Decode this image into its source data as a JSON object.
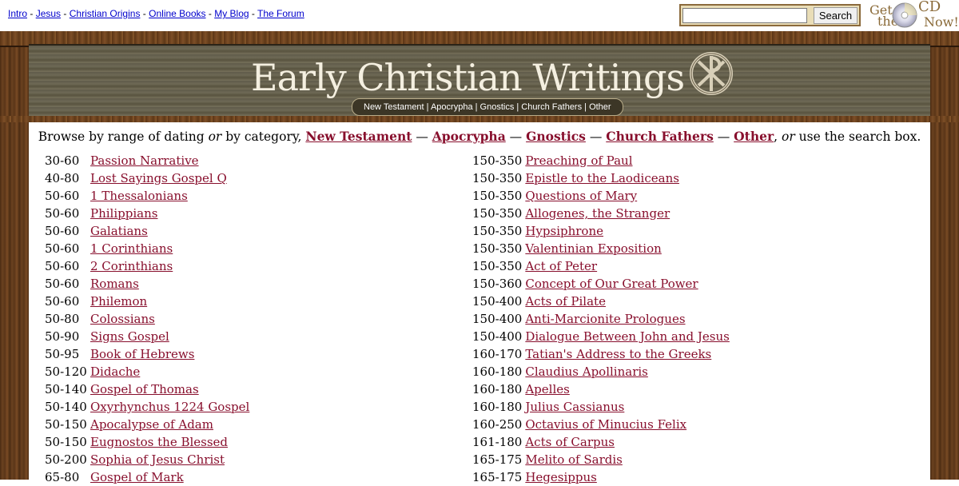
{
  "topnav": {
    "links": [
      "Intro",
      "Jesus",
      "Christian Origins",
      "Online Books",
      "My Blog",
      "The Forum"
    ],
    "separator": "-"
  },
  "search": {
    "value": "",
    "button_label": "Search"
  },
  "cd_promo": {
    "line1": "Get",
    "line2": "the",
    "line3": "CD",
    "line4": "Now!"
  },
  "header": {
    "title": "Early Christian Writings",
    "categories_bar": "New Testament | Apocrypha | Gnostics | Church Fathers | Other"
  },
  "intro": {
    "text1": "Browse by range of dating ",
    "or1": "or",
    "text2": " by category, ",
    "cat1": "New Testament",
    "dash1": " — ",
    "cat2": "Apocrypha",
    "dash2": " — ",
    "cat3": "Gnostics",
    "dash3": " — ",
    "cat4": "Church Fathers",
    "dash4": " — ",
    "cat5": "Other",
    "comma": ", ",
    "or2": "or",
    "text3": " use the search box."
  },
  "left_list": [
    {
      "date": "30-60",
      "title": "Passion Narrative"
    },
    {
      "date": "40-80",
      "title": "Lost Sayings Gospel Q"
    },
    {
      "date": "50-60",
      "title": "1 Thessalonians"
    },
    {
      "date": "50-60",
      "title": "Philippians"
    },
    {
      "date": "50-60",
      "title": "Galatians"
    },
    {
      "date": "50-60",
      "title": "1 Corinthians"
    },
    {
      "date": "50-60",
      "title": "2 Corinthians"
    },
    {
      "date": "50-60",
      "title": "Romans"
    },
    {
      "date": "50-60",
      "title": "Philemon"
    },
    {
      "date": "50-80",
      "title": "Colossians"
    },
    {
      "date": "50-90",
      "title": "Signs Gospel"
    },
    {
      "date": "50-95",
      "title": "Book of Hebrews"
    },
    {
      "date": "50-120",
      "title": "Didache"
    },
    {
      "date": "50-140",
      "title": "Gospel of Thomas"
    },
    {
      "date": "50-140",
      "title": "Oxyrhynchus 1224 Gospel"
    },
    {
      "date": "50-150",
      "title": "Apocalypse of Adam"
    },
    {
      "date": "50-150",
      "title": "Eugnostos the Blessed"
    },
    {
      "date": "50-200",
      "title": "Sophia of Jesus Christ"
    },
    {
      "date": "65-80",
      "title": "Gospel of Mark"
    }
  ],
  "right_list": [
    {
      "date": "150-350",
      "title": "Preaching of Paul"
    },
    {
      "date": "150-350",
      "title": "Epistle to the Laodiceans"
    },
    {
      "date": "150-350",
      "title": "Questions of Mary"
    },
    {
      "date": "150-350",
      "title": "Allogenes, the Stranger"
    },
    {
      "date": "150-350",
      "title": "Hypsiphrone"
    },
    {
      "date": "150-350",
      "title": "Valentinian Exposition"
    },
    {
      "date": "150-350",
      "title": "Act of Peter"
    },
    {
      "date": "150-360",
      "title": "Concept of Our Great Power"
    },
    {
      "date": "150-400",
      "title": "Acts of Pilate"
    },
    {
      "date": "150-400",
      "title": "Anti-Marcionite Prologues"
    },
    {
      "date": "150-400",
      "title": "Dialogue Between John and Jesus"
    },
    {
      "date": "160-170",
      "title": "Tatian's Address to the Greeks"
    },
    {
      "date": "160-180",
      "title": "Claudius Apollinaris"
    },
    {
      "date": "160-180",
      "title": "Apelles"
    },
    {
      "date": "160-180",
      "title": "Julius Cassianus"
    },
    {
      "date": "160-250",
      "title": "Octavius of Minucius Felix"
    },
    {
      "date": "161-180",
      "title": "Acts of Carpus"
    },
    {
      "date": "165-175",
      "title": "Melito of Sardis"
    },
    {
      "date": "165-175",
      "title": "Hegesippus"
    }
  ],
  "colors": {
    "link": "#880f2d",
    "nav_link": "#0000cc",
    "wood": "#6b4220"
  }
}
